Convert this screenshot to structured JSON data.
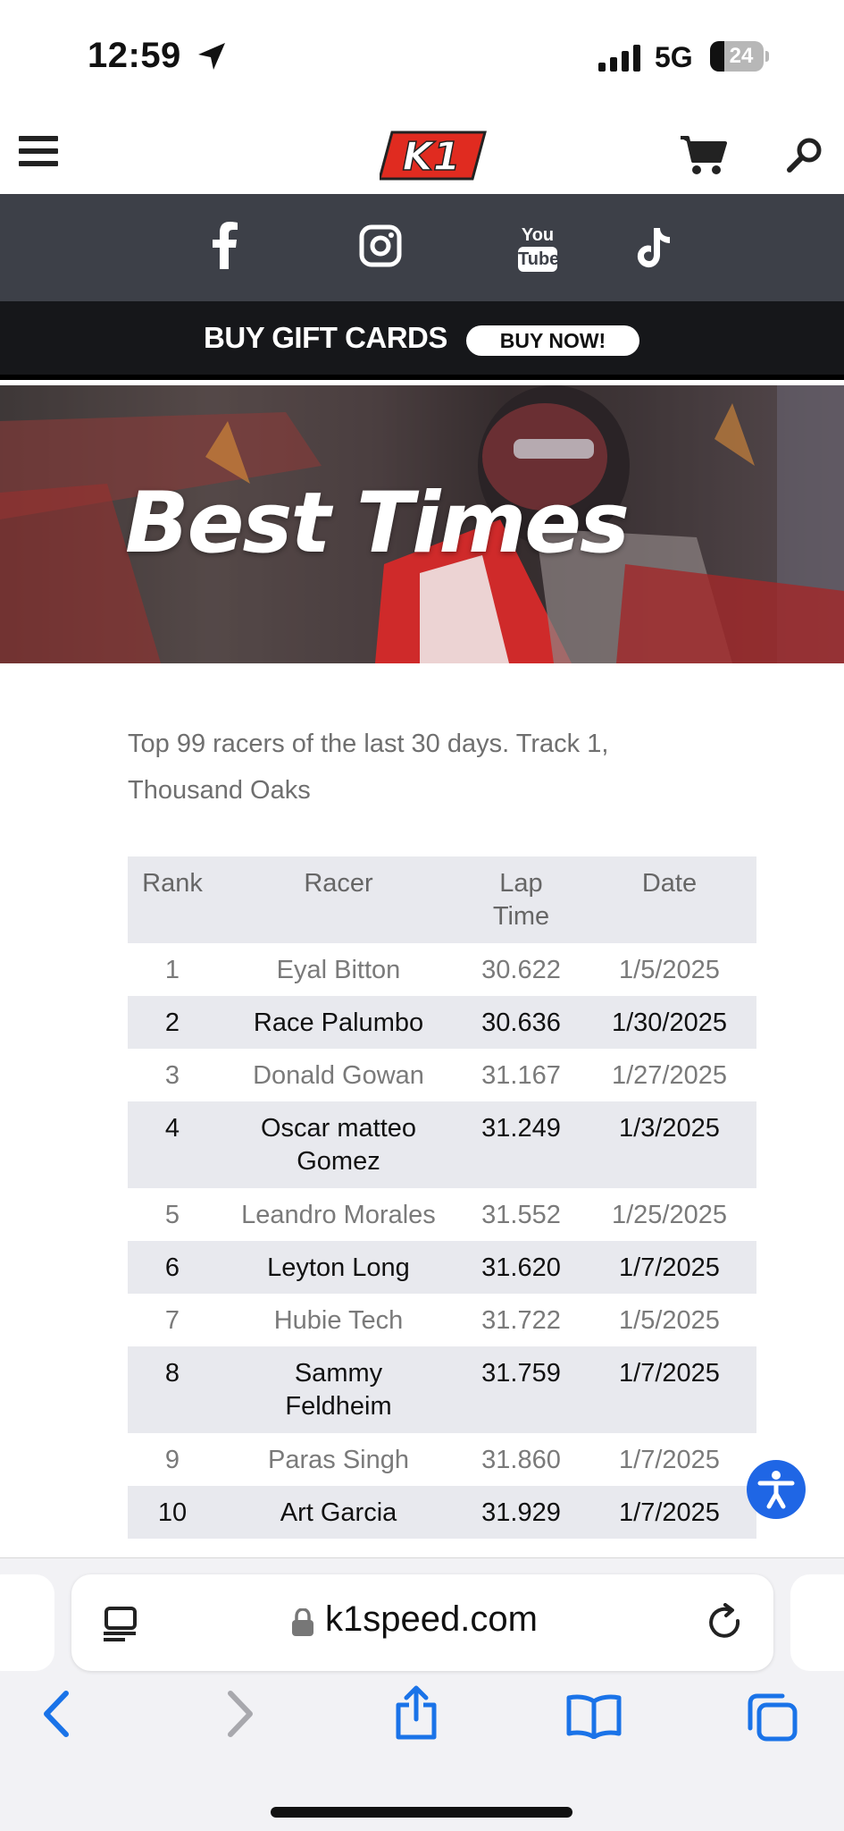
{
  "status_bar": {
    "time": "12:59",
    "network": "5G",
    "battery": "24"
  },
  "header": {
    "logo_text": "K1"
  },
  "social": {
    "icons": [
      "facebook-icon",
      "instagram-icon",
      "youtube-icon",
      "tiktok-icon"
    ],
    "youtube_line1": "You",
    "youtube_line2": "Tube"
  },
  "gift": {
    "text": "BUY GIFT CARDS",
    "button": "BUY NOW!"
  },
  "hero": {
    "title": "Best Times"
  },
  "intro": "Top 99 racers of the last 30 days. Track 1, Thousand Oaks",
  "table": {
    "headers": {
      "rank": "Rank",
      "racer": "Racer",
      "lap_time": "Lap Time",
      "date": "Date"
    },
    "rows": [
      {
        "rank": "1",
        "racer": "Eyal Bitton",
        "lap_time": "30.622",
        "date": "1/5/2025"
      },
      {
        "rank": "2",
        "racer": "Race Palumbo",
        "lap_time": "30.636",
        "date": "1/30/2025"
      },
      {
        "rank": "3",
        "racer": "Donald Gowan",
        "lap_time": "31.167",
        "date": "1/27/2025"
      },
      {
        "rank": "4",
        "racer": "Oscar matteo Gomez",
        "lap_time": "31.249",
        "date": "1/3/2025"
      },
      {
        "rank": "5",
        "racer": "Leandro Morales",
        "lap_time": "31.552",
        "date": "1/25/2025"
      },
      {
        "rank": "6",
        "racer": "Leyton Long",
        "lap_time": "31.620",
        "date": "1/7/2025"
      },
      {
        "rank": "7",
        "racer": "Hubie Tech",
        "lap_time": "31.722",
        "date": "1/5/2025"
      },
      {
        "rank": "8",
        "racer": "Sammy Feldheim",
        "lap_time": "31.759",
        "date": "1/7/2025"
      },
      {
        "rank": "9",
        "racer": "Paras Singh",
        "lap_time": "31.860",
        "date": "1/7/2025"
      },
      {
        "rank": "10",
        "racer": "Art Garcia",
        "lap_time": "31.929",
        "date": "1/7/2025"
      }
    ]
  },
  "browser": {
    "url": "k1speed.com"
  },
  "colors": {
    "brand_red": "#e02b20",
    "social_bar": "#3d4048",
    "gift_bar": "#16171a",
    "accessibility_blue": "#1f66e5",
    "ios_blue": "#1a73e8"
  }
}
